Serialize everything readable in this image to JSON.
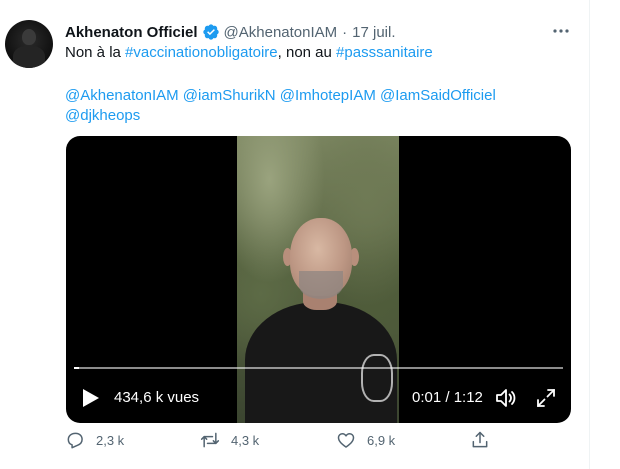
{
  "tweet": {
    "display_name": "Akhenaton Officiel",
    "handle": "@AkhenatonIAM",
    "separator": "·",
    "date": "17 juil.",
    "text": {
      "prefix": "Non à la ",
      "hashtag1": "#vaccinationobligatoire",
      "middle": ", non au ",
      "hashtag2": "#passsanitaire"
    },
    "mentions": [
      "@AkhenatonIAM",
      "@iamShurikN",
      "@ImhotepIAM",
      "@IamSaidOfficiel",
      "@djkheops"
    ]
  },
  "video": {
    "views": "434,6 k vues",
    "time": "0:01 / 1:12",
    "progress": 0.01
  },
  "actions": {
    "reply_count": "2,3 k",
    "retweet_count": "4,3 k",
    "like_count": "6,9 k"
  },
  "icons": {
    "verified": "verified-badge-icon",
    "more": "more-options-icon",
    "play": "play-icon",
    "volume": "volume-icon",
    "fullscreen": "fullscreen-icon",
    "reply": "reply-icon",
    "retweet": "retweet-icon",
    "like": "like-icon",
    "share": "share-icon"
  },
  "colors": {
    "accent": "#1d9bf0",
    "secondary_text": "#536471",
    "primary_text": "#0f1419"
  }
}
